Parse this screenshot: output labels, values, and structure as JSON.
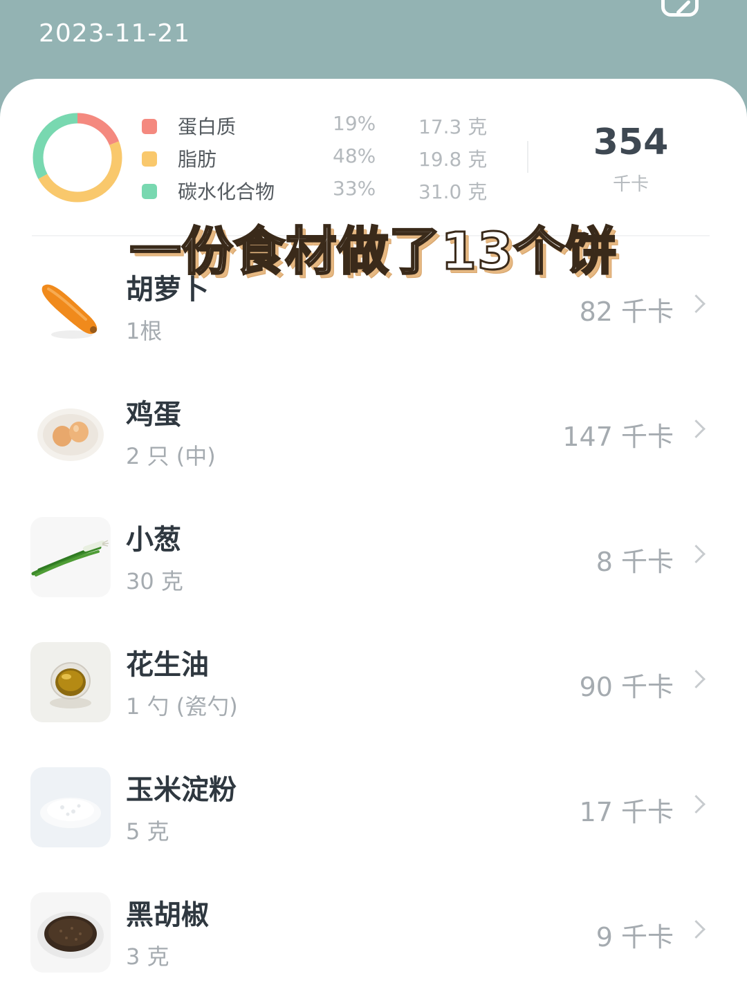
{
  "header": {
    "date": "2023-11-21"
  },
  "summary": {
    "macros": [
      {
        "name": "蛋白质",
        "percent": "19%",
        "grams": "17.3 克",
        "color": "#f4897f"
      },
      {
        "name": "脂肪",
        "percent": "48%",
        "grams": "19.8 克",
        "color": "#f9c86c"
      },
      {
        "name": "碳水化合物",
        "percent": "33%",
        "grams": "31.0 克",
        "color": "#78d8b0"
      }
    ],
    "total_kcal": "354",
    "total_unit": "千卡"
  },
  "overlay": {
    "title": "一份食材做了13个饼"
  },
  "foods": [
    {
      "name": "胡萝卜",
      "amount": "1根",
      "kcal": "82 千卡",
      "icon": "carrot-image"
    },
    {
      "name": "鸡蛋",
      "amount": "2 只 (中)",
      "kcal": "147 千卡",
      "icon": "egg-image"
    },
    {
      "name": "小葱",
      "amount": "30 克",
      "kcal": "8 千卡",
      "icon": "scallion-image"
    },
    {
      "name": "花生油",
      "amount": "1 勺 (瓷勺)",
      "kcal": "90 千卡",
      "icon": "oil-image"
    },
    {
      "name": "玉米淀粉",
      "amount": "5 克",
      "kcal": "17 千卡",
      "icon": "cornstarch-image"
    },
    {
      "name": "黑胡椒",
      "amount": "3 克",
      "kcal": "9 千卡",
      "icon": "pepper-image"
    }
  ]
}
